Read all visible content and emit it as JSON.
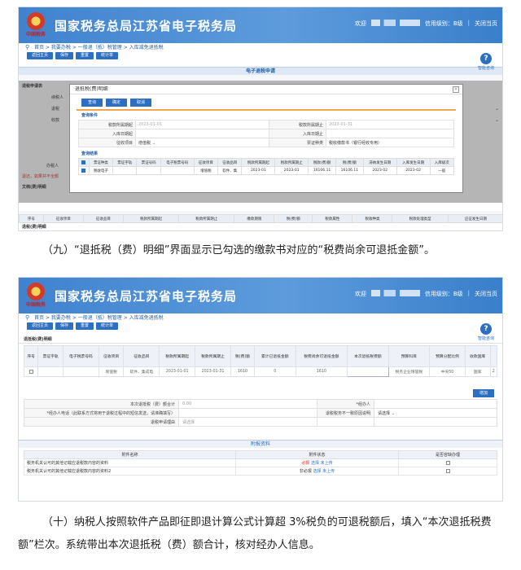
{
  "banner": {
    "title": "国家税务总局江苏省电子税务局",
    "welcome": "欢迎",
    "credit": "信用级别：B级",
    "close": "关闭当页",
    "emblem_text": "中国税务"
  },
  "breadcrumb": [
    "首页",
    "我要办税",
    "一般退（抵）税管理",
    "入库减免退抵税"
  ],
  "tabs": [
    "返回主页",
    "保存",
    "重置",
    "统计单"
  ],
  "help": "智能咨询",
  "shot1": {
    "band_title": "电子退税申请",
    "left_labels": [
      "退税申请表",
      "纳税人",
      "退税",
      "收款",
      "",
      "",
      "",
      "办税人",
      "退还，如果并不全额",
      "文档(费)明细"
    ],
    "modal_title": "退抵税(费)明细",
    "modal_buttons": [
      "查询",
      "确定",
      "取消"
    ],
    "query_title": "查询条件",
    "query": [
      {
        "label": "税款所属期起",
        "value": "2023-01-01",
        "label2": "税款所属期止",
        "value2": "2023-01-31"
      },
      {
        "label": "入库日期起",
        "value": "",
        "label2": "入库日期止",
        "value2": ""
      },
      {
        "label": "征收项目",
        "value": "增值税",
        "label2": "票证种类",
        "value2": "税收缴款书（银行经收专用）"
      }
    ],
    "result_title": "查询结果",
    "result_headers": [
      "",
      "票证种类",
      "票证字轨",
      "票证号码",
      "电子税票号码",
      "征收项目",
      "征收品目",
      "税款所属期起",
      "税款所属期止",
      "税款(费)额",
      "税(费)额",
      "滞纳发生日期",
      "入库发生日期",
      "入库级次"
    ],
    "result_row": [
      "",
      "税收电子",
      "",
      "",
      "",
      "增值税",
      "软件、集",
      "2023-01",
      "2023-01",
      "16106.11",
      "16106.11",
      "2023-02",
      "2023-02",
      "一般"
    ],
    "bottom_headers": [
      "序号",
      "征收项目",
      "征收品目",
      "税款所属期起",
      "税款所属期止",
      "缴款期限",
      "税(费)额",
      "税款属性",
      "税收种类",
      "税款处理类型",
      "应征发生日期"
    ],
    "bottom_label": "退税(费)明细"
  },
  "caption1": "（九）“退抵税（费）明细”界面显示已勾选的缴款书对应的“税费尚余可退抵金额”。",
  "shot2": {
    "section_title": "退抵税(费)明细",
    "headers": [
      "序号",
      "票证字轨",
      "电子税票号码",
      "征收项目",
      "征收品目",
      "税款所属期起",
      "税款所属期止",
      "税(费)额",
      "累计已退抵金额",
      "税费尚余可退抵金额",
      "本次退抵税费额",
      "预算科目",
      "预算分配比例",
      "收款国库",
      ""
    ],
    "row": [
      "",
      "",
      "",
      "增值税",
      "软件、集成电",
      "2023-01-01",
      "2023-01-31",
      "1610",
      "0",
      "1610",
      "",
      "税务企业增值税",
      "中央50",
      "国家",
      "2"
    ],
    "add_button": "增加",
    "form": [
      {
        "label": "本次退抵税（费）额合计",
        "value": "0.00",
        "label2": "*经办人",
        "value2": ""
      },
      {
        "label": "*经办人电话（此联系方式将用于退税过程中的短信发送，请准确填写）",
        "value": "",
        "label2": "退税税务不一致原因说明",
        "value2": "请选择"
      },
      {
        "label": "退税申请理由",
        "value": "请选择",
        "label2": "",
        "value2": ""
      }
    ],
    "attach_title": "附报资料",
    "attach_headers": [
      "附件名称",
      "附件状态",
      "是否容缺办理"
    ],
    "attach_rows": [
      {
        "name": "税务机关认可的其他记载应退税款内容的资料",
        "req": "必报",
        "a1": "选择",
        "a2": "未上传"
      },
      {
        "name": "税务机关认可的其他记载应退税款内容的资料2",
        "req": "非必报",
        "a1": "选择",
        "a2": "未上传"
      }
    ]
  },
  "caption2": "（十）纳税人按照软件产品即征即退计算公式计算超 3%税负的可退税额后，填入“本次退抵税费额”栏次。系统带出本次退抵税（费）额合计，核对经办人信息。"
}
